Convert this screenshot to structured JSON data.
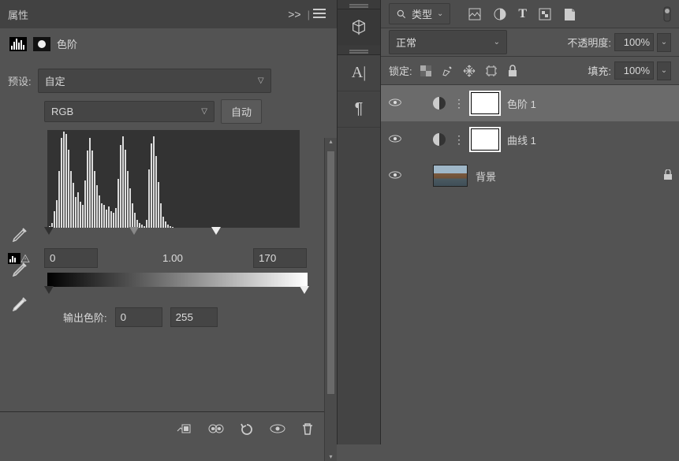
{
  "panel": {
    "title": "属性",
    "collapse": ">>",
    "adj_name": "色阶",
    "preset_label": "预设:",
    "preset_value": "自定",
    "channel_value": "RGB",
    "auto_btn": "自动",
    "input_black": "0",
    "input_gamma": "1.00",
    "input_white": "170",
    "output_label": "输出色阶:",
    "output_black": "0",
    "output_white": "255"
  },
  "histogram": {
    "bars": [
      2,
      6,
      20,
      34,
      70,
      110,
      118,
      115,
      96,
      70,
      55,
      38,
      44,
      32,
      28,
      58,
      95,
      110,
      95,
      70,
      52,
      40,
      30,
      28,
      22,
      26,
      20,
      18,
      24,
      60,
      102,
      112,
      96,
      70,
      48,
      30,
      18,
      10,
      6,
      4,
      2,
      10,
      72,
      104,
      112,
      88,
      56,
      30,
      14,
      8,
      4,
      2,
      1,
      0,
      0,
      0,
      0,
      0,
      0,
      0,
      0,
      0,
      0,
      0,
      0,
      0,
      0,
      0,
      0,
      0,
      0,
      0,
      0,
      0,
      0,
      0,
      0,
      0
    ]
  },
  "layers_panel": {
    "filter_label": "类型",
    "blend_mode": "正常",
    "opacity_label": "不透明度:",
    "opacity_value": "100%",
    "lock_label": "锁定:",
    "fill_label": "填充:",
    "fill_value": "100%",
    "layers": [
      {
        "name": "色阶 1",
        "type": "adjustment",
        "selected": true
      },
      {
        "name": "曲线 1",
        "type": "adjustment",
        "selected": false
      },
      {
        "name": "背景",
        "type": "image",
        "locked": true
      }
    ]
  }
}
